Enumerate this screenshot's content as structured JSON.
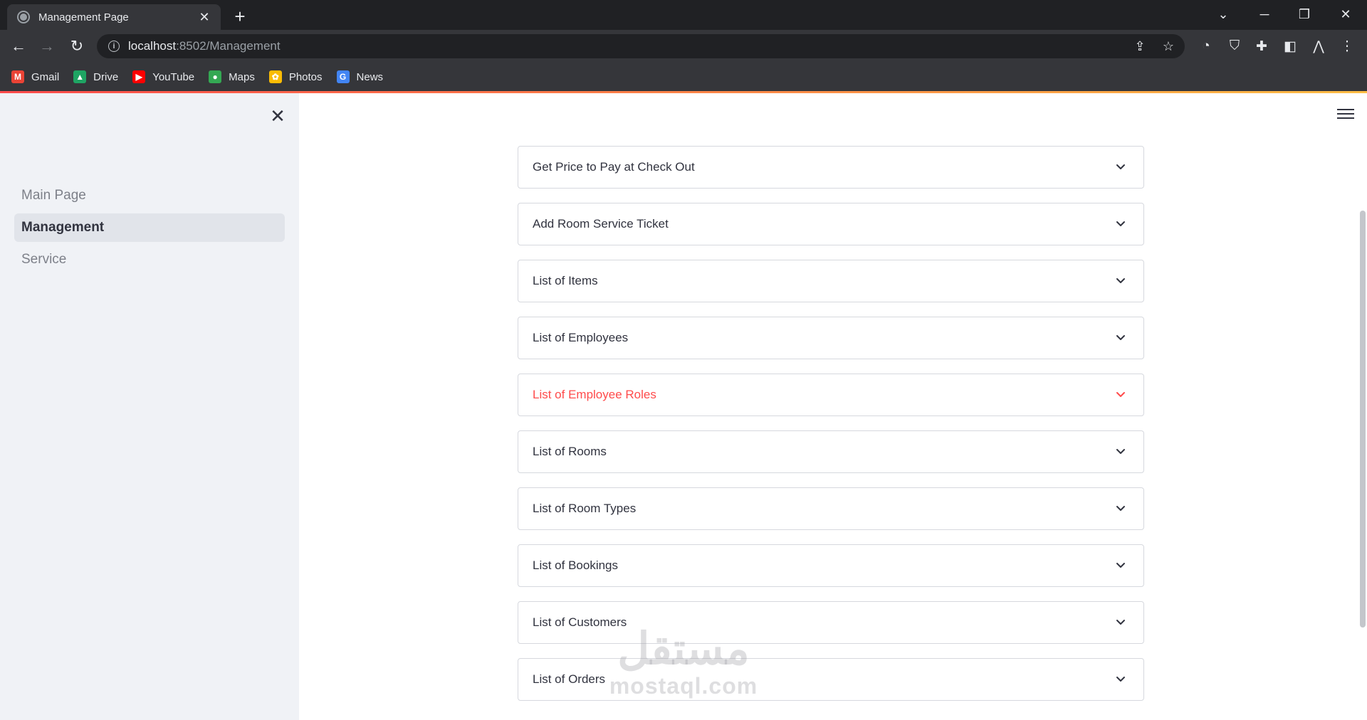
{
  "browser": {
    "tab_title": "Management Page",
    "tab_close": "✕",
    "new_tab": "+",
    "url_host": "localhost",
    "url_path": ":8502/Management",
    "bookmarks": [
      {
        "label": "Gmail",
        "icon": "gmail-icon",
        "color": "#ea4335",
        "glyph": "M"
      },
      {
        "label": "Drive",
        "icon": "drive-icon",
        "color": "#1fa463",
        "glyph": "▲"
      },
      {
        "label": "YouTube",
        "icon": "youtube-icon",
        "color": "#ff0000",
        "glyph": "▶"
      },
      {
        "label": "Maps",
        "icon": "maps-icon",
        "color": "#34a853",
        "glyph": "●"
      },
      {
        "label": "Photos",
        "icon": "photos-icon",
        "color": "#fbbc04",
        "glyph": "✿"
      },
      {
        "label": "News",
        "icon": "news-icon",
        "color": "#4285f4",
        "glyph": "G"
      }
    ]
  },
  "sidebar": {
    "close_glyph": "✕",
    "items": [
      {
        "label": "Main Page",
        "active": false
      },
      {
        "label": "Management",
        "active": true
      },
      {
        "label": "Service",
        "active": false
      }
    ]
  },
  "main": {
    "expanders": [
      {
        "label": "Get Price to Pay at Check Out",
        "hover": false
      },
      {
        "label": "Add Room Service Ticket",
        "hover": false
      },
      {
        "label": "List of Items",
        "hover": false
      },
      {
        "label": "List of Employees",
        "hover": false
      },
      {
        "label": "List of Employee Roles",
        "hover": true
      },
      {
        "label": "List of Rooms",
        "hover": false
      },
      {
        "label": "List of Room Types",
        "hover": false
      },
      {
        "label": "List of Bookings",
        "hover": false
      },
      {
        "label": "List of Customers",
        "hover": false
      },
      {
        "label": "List of Orders",
        "hover": false
      }
    ],
    "watermark_ar": "مستقل",
    "watermark_en": "mostaql.com"
  },
  "colors": {
    "accent": "#ff4b4b",
    "text": "#31333f",
    "sidebar_bg": "#f0f2f6"
  }
}
